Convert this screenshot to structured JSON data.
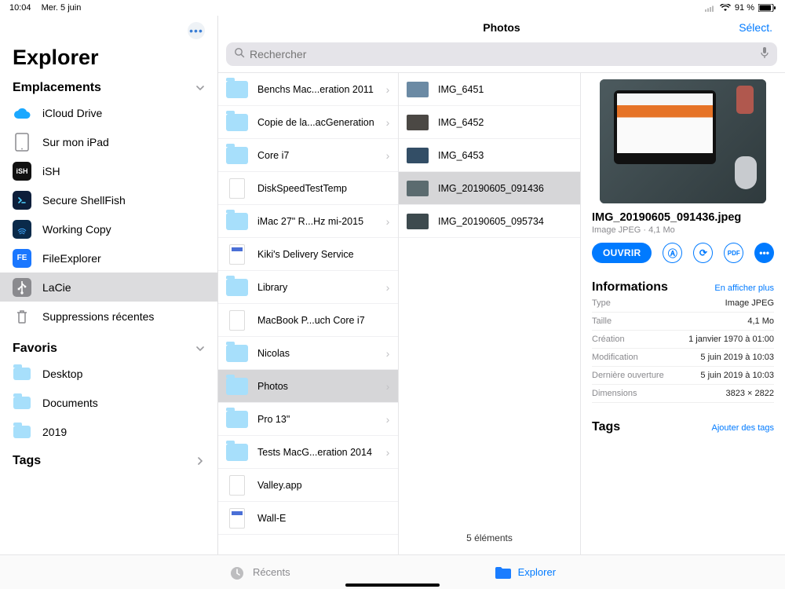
{
  "statusbar": {
    "time": "10:04",
    "date": "Mer. 5 juin",
    "battery": "91 %"
  },
  "sidebar": {
    "title": "Explorer",
    "sections_emplacements": "Emplacements",
    "section_favoris": "Favoris",
    "section_tags": "Tags",
    "emplacements": [
      {
        "label": "iCloud Drive"
      },
      {
        "label": "Sur mon iPad"
      },
      {
        "label": "iSH"
      },
      {
        "label": "Secure ShellFish"
      },
      {
        "label": "Working Copy"
      },
      {
        "label": "FileExplorer"
      },
      {
        "label": "LaCie"
      },
      {
        "label": "Suppressions récentes"
      }
    ],
    "favoris": [
      {
        "label": "Desktop"
      },
      {
        "label": "Documents"
      },
      {
        "label": "2019"
      }
    ]
  },
  "header": {
    "title": "Photos",
    "select": "Sélect."
  },
  "search": {
    "placeholder": "Rechercher"
  },
  "col1": [
    {
      "label": "Benchs Mac...eration 2011",
      "kind": "folder",
      "chev": true
    },
    {
      "label": "Copie de la...acGeneration",
      "kind": "folder",
      "chev": true
    },
    {
      "label": "Core i7",
      "kind": "folder",
      "chev": true
    },
    {
      "label": "DiskSpeedTestTemp",
      "kind": "file",
      "chev": false
    },
    {
      "label": "iMac 27\" R...Hz mi-2015",
      "kind": "folder",
      "chev": true
    },
    {
      "label": "Kiki's Delivery Service",
      "kind": "clap",
      "chev": false
    },
    {
      "label": "Library",
      "kind": "folder",
      "chev": true
    },
    {
      "label": "MacBook P...uch Core i7",
      "kind": "file",
      "chev": false
    },
    {
      "label": "Nicolas",
      "kind": "folder",
      "chev": true
    },
    {
      "label": "Photos",
      "kind": "folder",
      "chev": true,
      "selected": true
    },
    {
      "label": "Pro 13\"",
      "kind": "folder",
      "chev": true
    },
    {
      "label": "Tests MacG...eration 2014",
      "kind": "folder",
      "chev": true
    },
    {
      "label": "Valley.app",
      "kind": "file",
      "chev": false
    },
    {
      "label": "Wall-E",
      "kind": "clap",
      "chev": false
    }
  ],
  "col2": {
    "items": [
      {
        "label": "IMG_6451",
        "thumb": "#6b8aa4"
      },
      {
        "label": "IMG_6452",
        "thumb": "#4b4844"
      },
      {
        "label": "IMG_6453",
        "thumb": "#334e66"
      },
      {
        "label": "IMG_20190605_091436",
        "thumb": "#5b6b6f",
        "selected": true
      },
      {
        "label": "IMG_20190605_095734",
        "thumb": "#3d4a4e"
      }
    ],
    "count": "5 éléments"
  },
  "preview": {
    "filename": "IMG_20190605_091436.jpeg",
    "subtitle": "Image JPEG · 4,1 Mo",
    "open": "OUVRIR",
    "info_title": "Informations",
    "info_more": "En afficher plus",
    "tags_title": "Tags",
    "tags_add": "Ajouter des tags",
    "info": [
      {
        "k": "Type",
        "v": "Image JPEG"
      },
      {
        "k": "Taille",
        "v": "4,1 Mo"
      },
      {
        "k": "Création",
        "v": "1 janvier 1970 à 01:00"
      },
      {
        "k": "Modification",
        "v": "5 juin 2019 à 10:03"
      },
      {
        "k": "Dernière ouverture",
        "v": "5 juin 2019 à 10:03"
      },
      {
        "k": "Dimensions",
        "v": "3823 × 2822"
      }
    ]
  },
  "tabs": {
    "recents": "Récents",
    "explorer": "Explorer"
  }
}
